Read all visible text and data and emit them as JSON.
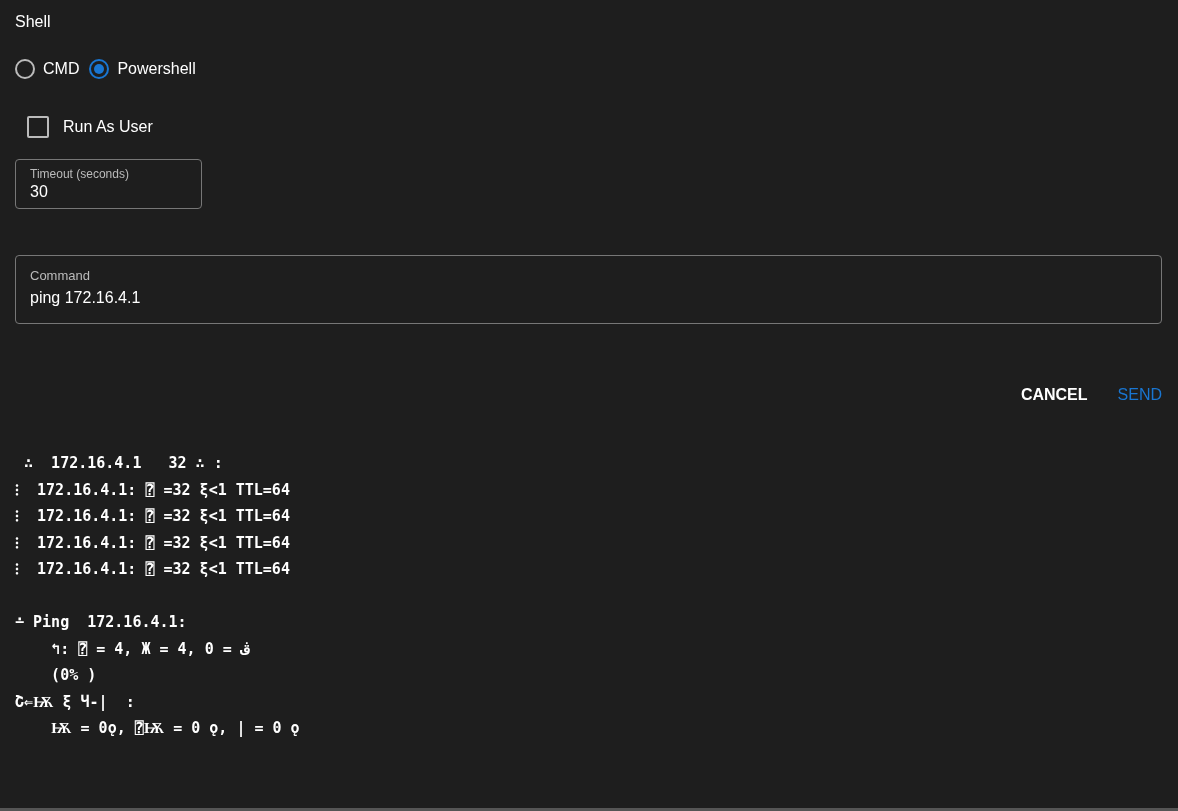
{
  "shell": {
    "label": "Shell",
    "options": [
      {
        "label": "CMD",
        "selected": false
      },
      {
        "label": "Powershell",
        "selected": true
      }
    ]
  },
  "run_as_user": {
    "label": "Run As User",
    "checked": false
  },
  "timeout": {
    "label": "Timeout (seconds)",
    "value": "30"
  },
  "command": {
    "label": "Command",
    "value": "ping 172.16.4.1"
  },
  "buttons": [
    {
      "label": "CANCEL",
      "kind": "plain"
    },
    {
      "label": "SEND",
      "kind": "primary"
    }
  ],
  "output": [
    [
      " ∴  172.16.4.1   32 ∴ :",
      "⁝  172.16.4.1: ⍰ =32 ξ<1 TTL=64",
      "⁝  172.16.4.1: ⍰ =32 ξ<1 TTL=64",
      "⁝  172.16.4.1: ⍰ =32 ξ<1 TTL=64",
      "⁝  172.16.4.1: ⍰ =32 ξ<1 TTL=64"
    ],
    [
      "∸ Ping  172.16.4.1:",
      "    ↰: ⍰ = 4, Ж = 4, 0 = ڤ",
      "    (0% )",
      "Շ⇐Ѭ ξ Ч-|  :",
      "    Ѭ = 0ǫ, ⍰Ѭ = 0 ǫ, | = 0 ǫ"
    ]
  ]
}
